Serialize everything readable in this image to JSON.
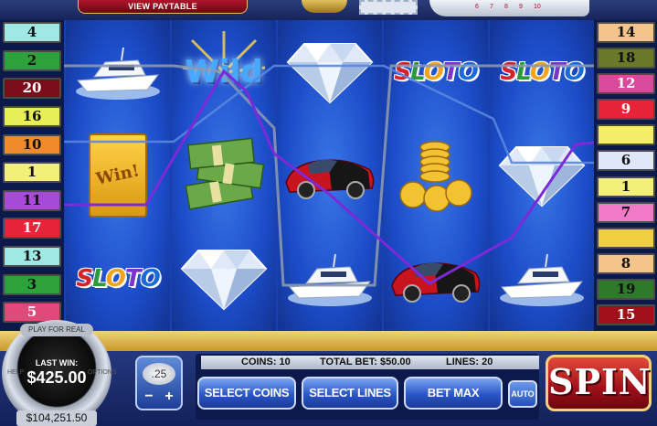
{
  "header": {
    "paytable_label": "VIEW PAYTABLE",
    "line_numbers": [
      "6",
      "7",
      "8",
      "9",
      "10"
    ]
  },
  "left_lines": [
    {
      "n": "4",
      "color": "#9fe8e4"
    },
    {
      "n": "2",
      "color": "#2ea23a"
    },
    {
      "n": "20",
      "color": "#7a0e1a"
    },
    {
      "n": "16",
      "color": "#e6ee58"
    },
    {
      "n": "10",
      "color": "#f08a2a"
    },
    {
      "n": "1",
      "color": "#f2f07a"
    },
    {
      "n": "11",
      "color": "#a84ad8"
    },
    {
      "n": "17",
      "color": "#e8243a"
    },
    {
      "n": "13",
      "color": "#9fe8e4"
    },
    {
      "n": "3",
      "color": "#2ea23a"
    },
    {
      "n": "5",
      "color": "#e04a7a"
    }
  ],
  "right_lines": [
    {
      "n": "14",
      "color": "#f4c48a"
    },
    {
      "n": "18",
      "color": "#6a7a2a"
    },
    {
      "n": "12",
      "color": "#d84a9a"
    },
    {
      "n": "9",
      "color": "#e8243a"
    },
    {
      "n": "",
      "color": "#f4ee6a"
    },
    {
      "n": "6",
      "color": "#dfe8f8"
    },
    {
      "n": "1",
      "color": "#f2f07a"
    },
    {
      "n": "7",
      "color": "#f07ac8"
    },
    {
      "n": "",
      "color": "#f0d040"
    },
    {
      "n": "8",
      "color": "#f4c48a"
    },
    {
      "n": "19",
      "color": "#2e7a2a"
    },
    {
      "n": "15",
      "color": "#a0101a"
    }
  ],
  "reels": [
    [
      "yacht",
      "ticket",
      "sloto"
    ],
    [
      "wild",
      "cash",
      "diamond"
    ],
    [
      "diamond",
      "car",
      "yacht"
    ],
    [
      "sloto",
      "coins",
      "car"
    ],
    [
      "sloto",
      "diamond",
      "yacht"
    ]
  ],
  "symbols": {
    "sloto_letters": [
      "S",
      "L",
      "O",
      "T",
      "O"
    ],
    "ticket_text": "Win!",
    "wild_text": "Wild"
  },
  "dial": {
    "play_real": "PLAY FOR REAL",
    "last_win_label": "LAST WIN:",
    "last_win_value": "$425.00",
    "balance": "$104,251.50",
    "left_word": "HELP",
    "right_word": "OPTIONS"
  },
  "coins": {
    "value": ".25",
    "minus": "−",
    "plus": "+"
  },
  "info": {
    "coins": "COINS: 10",
    "total_bet": "TOTAL BET: $50.00",
    "lines": "LINES: 20"
  },
  "controls": {
    "select_coins": "SELECT COINS",
    "select_lines": "SELECT LINES",
    "bet_max": "BET MAX",
    "auto": "AUTO",
    "spin": "SPIN"
  },
  "colors": {
    "line_grey": "#8a98b0",
    "line_purple": "#7a2ad8",
    "line_blue": "#5a86e0"
  }
}
